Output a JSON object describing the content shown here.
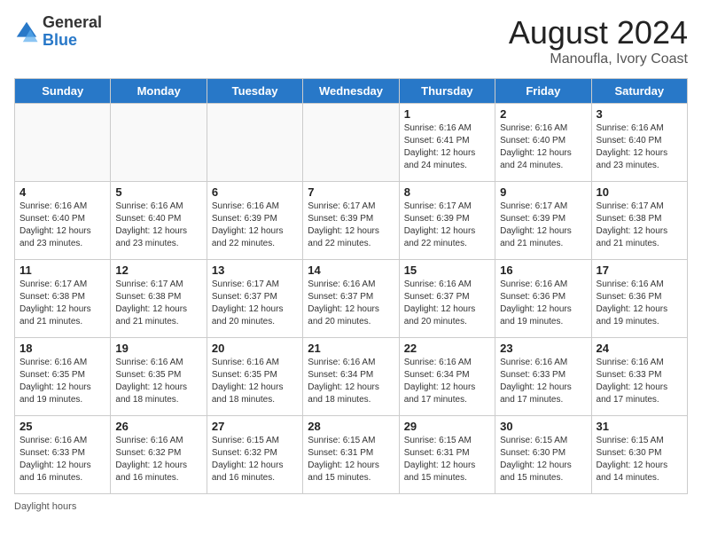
{
  "header": {
    "logo_general": "General",
    "logo_blue": "Blue",
    "title": "August 2024",
    "subtitle": "Manoufla, Ivory Coast"
  },
  "days_of_week": [
    "Sunday",
    "Monday",
    "Tuesday",
    "Wednesday",
    "Thursday",
    "Friday",
    "Saturday"
  ],
  "weeks": [
    [
      {
        "day": "",
        "info": ""
      },
      {
        "day": "",
        "info": ""
      },
      {
        "day": "",
        "info": ""
      },
      {
        "day": "",
        "info": ""
      },
      {
        "day": "1",
        "info": "Sunrise: 6:16 AM\nSunset: 6:41 PM\nDaylight: 12 hours and 24 minutes."
      },
      {
        "day": "2",
        "info": "Sunrise: 6:16 AM\nSunset: 6:40 PM\nDaylight: 12 hours and 24 minutes."
      },
      {
        "day": "3",
        "info": "Sunrise: 6:16 AM\nSunset: 6:40 PM\nDaylight: 12 hours and 23 minutes."
      }
    ],
    [
      {
        "day": "4",
        "info": "Sunrise: 6:16 AM\nSunset: 6:40 PM\nDaylight: 12 hours and 23 minutes."
      },
      {
        "day": "5",
        "info": "Sunrise: 6:16 AM\nSunset: 6:40 PM\nDaylight: 12 hours and 23 minutes."
      },
      {
        "day": "6",
        "info": "Sunrise: 6:16 AM\nSunset: 6:39 PM\nDaylight: 12 hours and 22 minutes."
      },
      {
        "day": "7",
        "info": "Sunrise: 6:17 AM\nSunset: 6:39 PM\nDaylight: 12 hours and 22 minutes."
      },
      {
        "day": "8",
        "info": "Sunrise: 6:17 AM\nSunset: 6:39 PM\nDaylight: 12 hours and 22 minutes."
      },
      {
        "day": "9",
        "info": "Sunrise: 6:17 AM\nSunset: 6:39 PM\nDaylight: 12 hours and 21 minutes."
      },
      {
        "day": "10",
        "info": "Sunrise: 6:17 AM\nSunset: 6:38 PM\nDaylight: 12 hours and 21 minutes."
      }
    ],
    [
      {
        "day": "11",
        "info": "Sunrise: 6:17 AM\nSunset: 6:38 PM\nDaylight: 12 hours and 21 minutes."
      },
      {
        "day": "12",
        "info": "Sunrise: 6:17 AM\nSunset: 6:38 PM\nDaylight: 12 hours and 21 minutes."
      },
      {
        "day": "13",
        "info": "Sunrise: 6:17 AM\nSunset: 6:37 PM\nDaylight: 12 hours and 20 minutes."
      },
      {
        "day": "14",
        "info": "Sunrise: 6:16 AM\nSunset: 6:37 PM\nDaylight: 12 hours and 20 minutes."
      },
      {
        "day": "15",
        "info": "Sunrise: 6:16 AM\nSunset: 6:37 PM\nDaylight: 12 hours and 20 minutes."
      },
      {
        "day": "16",
        "info": "Sunrise: 6:16 AM\nSunset: 6:36 PM\nDaylight: 12 hours and 19 minutes."
      },
      {
        "day": "17",
        "info": "Sunrise: 6:16 AM\nSunset: 6:36 PM\nDaylight: 12 hours and 19 minutes."
      }
    ],
    [
      {
        "day": "18",
        "info": "Sunrise: 6:16 AM\nSunset: 6:35 PM\nDaylight: 12 hours and 19 minutes."
      },
      {
        "day": "19",
        "info": "Sunrise: 6:16 AM\nSunset: 6:35 PM\nDaylight: 12 hours and 18 minutes."
      },
      {
        "day": "20",
        "info": "Sunrise: 6:16 AM\nSunset: 6:35 PM\nDaylight: 12 hours and 18 minutes."
      },
      {
        "day": "21",
        "info": "Sunrise: 6:16 AM\nSunset: 6:34 PM\nDaylight: 12 hours and 18 minutes."
      },
      {
        "day": "22",
        "info": "Sunrise: 6:16 AM\nSunset: 6:34 PM\nDaylight: 12 hours and 17 minutes."
      },
      {
        "day": "23",
        "info": "Sunrise: 6:16 AM\nSunset: 6:33 PM\nDaylight: 12 hours and 17 minutes."
      },
      {
        "day": "24",
        "info": "Sunrise: 6:16 AM\nSunset: 6:33 PM\nDaylight: 12 hours and 17 minutes."
      }
    ],
    [
      {
        "day": "25",
        "info": "Sunrise: 6:16 AM\nSunset: 6:33 PM\nDaylight: 12 hours and 16 minutes."
      },
      {
        "day": "26",
        "info": "Sunrise: 6:16 AM\nSunset: 6:32 PM\nDaylight: 12 hours and 16 minutes."
      },
      {
        "day": "27",
        "info": "Sunrise: 6:15 AM\nSunset: 6:32 PM\nDaylight: 12 hours and 16 minutes."
      },
      {
        "day": "28",
        "info": "Sunrise: 6:15 AM\nSunset: 6:31 PM\nDaylight: 12 hours and 15 minutes."
      },
      {
        "day": "29",
        "info": "Sunrise: 6:15 AM\nSunset: 6:31 PM\nDaylight: 12 hours and 15 minutes."
      },
      {
        "day": "30",
        "info": "Sunrise: 6:15 AM\nSunset: 6:30 PM\nDaylight: 12 hours and 15 minutes."
      },
      {
        "day": "31",
        "info": "Sunrise: 6:15 AM\nSunset: 6:30 PM\nDaylight: 12 hours and 14 minutes."
      }
    ]
  ],
  "footer": {
    "daylight_label": "Daylight hours"
  }
}
